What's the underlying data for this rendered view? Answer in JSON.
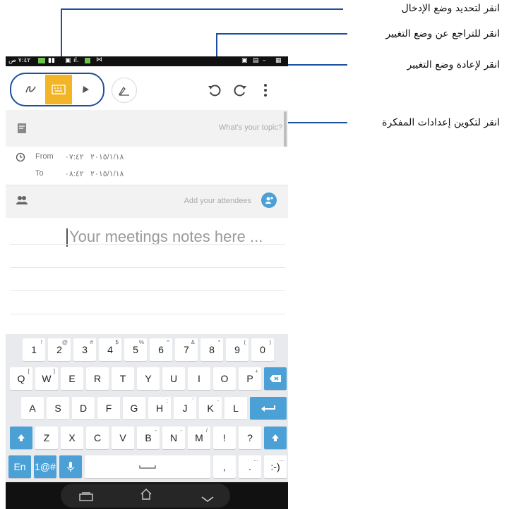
{
  "callouts": [
    {
      "text": "انقر لتحديد وضع الإدخال"
    },
    {
      "text": "انقر للتراجع عن وضع التغيير"
    },
    {
      "text": "انقر لإعادة وضع التغيير"
    },
    {
      "text": "انقر لتكوين إعدادات المفكرة"
    }
  ],
  "status_bar": {
    "time": "٧:٤٢ ص"
  },
  "toolbar": {
    "icons": [
      "handwriting-icon",
      "keyboard-icon",
      "pen-icon",
      "doodle-icon",
      "undo-icon",
      "redo-icon",
      "more-icon"
    ],
    "active_mode": "keyboard",
    "accent": "#f2b527"
  },
  "topic": {
    "placeholder": "What's your topic?"
  },
  "time": {
    "from_label": "From",
    "from_time": "٠٧:٤٢",
    "from_date": "٢٠١٥/١/١٨",
    "to_label": "To",
    "to_time": "٠٨:٤٢",
    "to_date": "٢٠١٥/١/١٨"
  },
  "attendees": {
    "placeholder": "Add your attendees"
  },
  "notes": {
    "placeholder": "Your meetings notes here ..."
  },
  "keyboard": {
    "row1": [
      {
        "k": "1",
        "s": "!"
      },
      {
        "k": "2",
        "s": "@"
      },
      {
        "k": "3",
        "s": "#"
      },
      {
        "k": "4",
        "s": "$"
      },
      {
        "k": "5",
        "s": "%"
      },
      {
        "k": "6",
        "s": "^"
      },
      {
        "k": "7",
        "s": "&"
      },
      {
        "k": "8",
        "s": "*"
      },
      {
        "k": "9",
        "s": "("
      },
      {
        "k": "0",
        "s": ")"
      }
    ],
    "row2": [
      {
        "k": "Q",
        "s": "["
      },
      {
        "k": "W",
        "s": "]"
      },
      {
        "k": "E",
        "s": ""
      },
      {
        "k": "R",
        "s": ""
      },
      {
        "k": "T",
        "s": ""
      },
      {
        "k": "Y",
        "s": ""
      },
      {
        "k": "U",
        "s": ""
      },
      {
        "k": "I",
        "s": ""
      },
      {
        "k": "O",
        "s": ""
      },
      {
        "k": "P",
        "s": "+"
      }
    ],
    "row3": [
      {
        "k": "A",
        "s": ""
      },
      {
        "k": "S",
        "s": ""
      },
      {
        "k": "D",
        "s": ""
      },
      {
        "k": "F",
        "s": ""
      },
      {
        "k": "G",
        "s": ""
      },
      {
        "k": "H",
        "s": ";"
      },
      {
        "k": "J",
        "s": "'"
      },
      {
        "k": "K",
        "s": "-"
      },
      {
        "k": "L",
        "s": ""
      }
    ],
    "row4": [
      {
        "k": "Z",
        "s": ""
      },
      {
        "k": "X",
        "s": ""
      },
      {
        "k": "C",
        "s": ""
      },
      {
        "k": "V",
        "s": ""
      },
      {
        "k": "B",
        "s": "-"
      },
      {
        "k": "N",
        "s": "-"
      },
      {
        "k": "M",
        "s": "/"
      },
      {
        "k": "!",
        "s": ""
      },
      {
        "k": "?",
        "s": ""
      }
    ],
    "lang": "En",
    "symbols": "1@#",
    "comma": ",",
    "period": ".",
    "smiley": ":-)",
    "more_dots": "...",
    "key_color": "#4ba1d6"
  },
  "colors": {
    "callout_line": "#1c4fa0",
    "accent": "#f2b527",
    "keyboard_blue": "#4ba1d6"
  }
}
